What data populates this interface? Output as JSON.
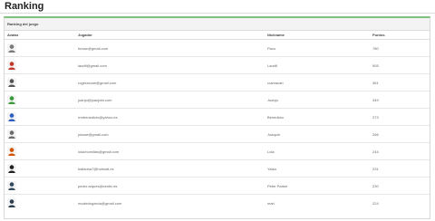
{
  "page": {
    "title": "Ranking"
  },
  "panel": {
    "heading": "Ranking del juego"
  },
  "table": {
    "headers": {
      "avatar": "Avatar",
      "jugador": "Jugador",
      "nickname": "Nickname",
      "puntos": "Puntos"
    },
    "rows": [
      {
        "email": "fursac@gmail.com",
        "nickname": "Paco",
        "puntos": "780",
        "avatar_icon": "robot-avatar-icon",
        "avatar_color": "#7a7a7a"
      },
      {
        "email": "laurifi@gmail.com",
        "nickname": "Laurifi",
        "puntos": "505",
        "avatar_icon": "superhero-avatar-icon",
        "avatar_color": "#c0392b"
      },
      {
        "email": "rogeraccari@gmail.com",
        "nickname": "rcamacari",
        "puntos": "361",
        "avatar_icon": "face-avatar-icon",
        "avatar_color": "#555555"
      },
      {
        "email": "juanjo@juanjofa.com",
        "nickname": "Juanjo",
        "puntos": "349",
        "avatar_icon": "hulk-avatar-icon",
        "avatar_color": "#3a9a3a"
      },
      {
        "email": "rmrbenedicto@yahoo.es",
        "nickname": "Benedicto",
        "puntos": "273",
        "avatar_icon": "superhero-avatar-icon",
        "avatar_color": "#2e5fbf"
      },
      {
        "email": "jolowe@gmail.com",
        "nickname": "Joaquin",
        "puntos": "266",
        "avatar_icon": "face-avatar-icon",
        "avatar_color": "#6b6b6b"
      },
      {
        "email": "lolachumillas@gmail.com",
        "nickname": "Lola",
        "puntos": "244",
        "avatar_icon": "superman-avatar-icon",
        "avatar_color": "#d35400"
      },
      {
        "email": "bailarina7@hotmail.es",
        "nickname": "Yaiza",
        "puntos": "231",
        "avatar_icon": "dark-avatar-icon",
        "avatar_color": "#222222"
      },
      {
        "email": "pedro.arques@centic.es",
        "nickname": "Peter Parker",
        "puntos": "230",
        "avatar_icon": "spiderman-avatar-icon",
        "avatar_color": "#34495e"
      },
      {
        "email": "mcaledogarcia@gmail.com",
        "nickname": "mari",
        "puntos": "224",
        "avatar_icon": "face-avatar-icon",
        "avatar_color": "#2c3e50"
      }
    ]
  }
}
